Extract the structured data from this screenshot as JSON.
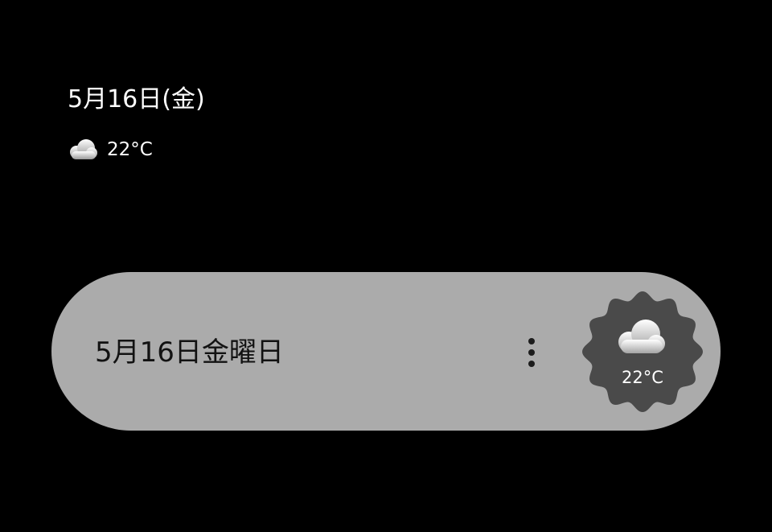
{
  "glance": {
    "date": "5月16日(金)",
    "weather_icon": "cloud-icon",
    "temperature": "22°C"
  },
  "widget": {
    "date": "5月16日金曜日",
    "menu_icon": "more-vert-icon",
    "weather_icon": "cloud-icon",
    "temperature": "22°C"
  },
  "colors": {
    "background": "#000000",
    "pill": "#ababab",
    "badge": "#4a4a4a",
    "text_light": "#ffffff",
    "text_dark": "#121212"
  }
}
